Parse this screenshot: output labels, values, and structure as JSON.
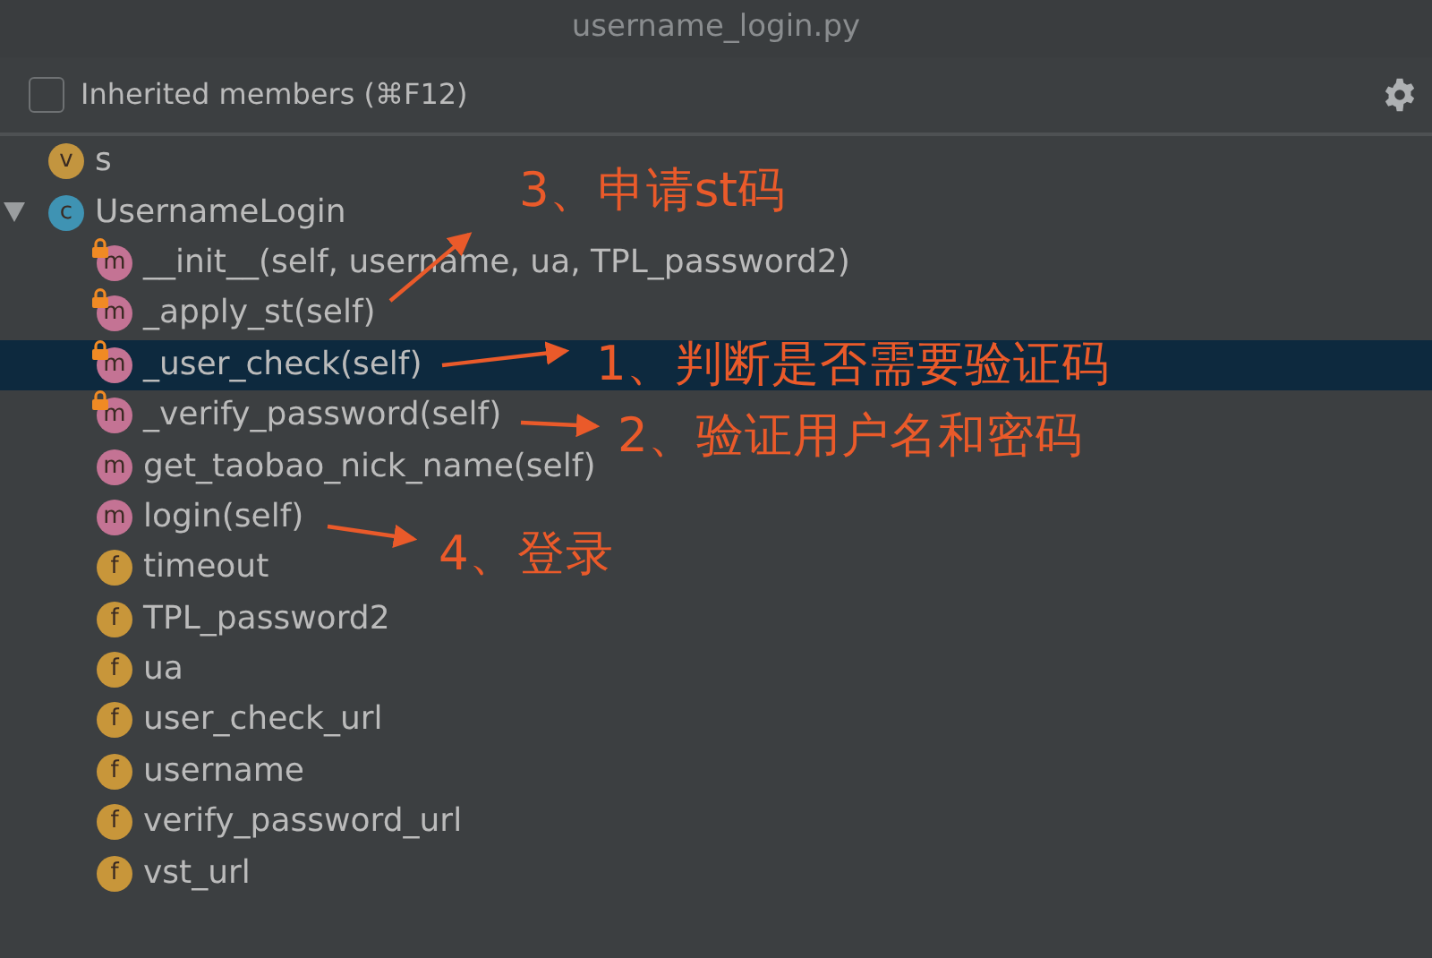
{
  "window": {
    "title": "username_login.py"
  },
  "inherited_members": {
    "label": "Inherited members (⌘F12)",
    "checked": false
  },
  "tree": [
    {
      "kind": "variable",
      "badge": "v",
      "label": "s",
      "locked": false,
      "selected": false
    },
    {
      "kind": "class",
      "badge": "c",
      "label": "UsernameLogin",
      "locked": false,
      "selected": false,
      "expanded": true,
      "children": [
        {
          "kind": "method",
          "badge": "m",
          "label": "__init__(self, username, ua, TPL_password2)",
          "locked": true,
          "selected": false
        },
        {
          "kind": "method",
          "badge": "m",
          "label": "_apply_st(self)",
          "locked": true,
          "selected": false
        },
        {
          "kind": "method",
          "badge": "m",
          "label": "_user_check(self)",
          "locked": true,
          "selected": true
        },
        {
          "kind": "method",
          "badge": "m",
          "label": "_verify_password(self)",
          "locked": true,
          "selected": false
        },
        {
          "kind": "method",
          "badge": "m",
          "label": "get_taobao_nick_name(self)",
          "locked": false,
          "selected": false
        },
        {
          "kind": "method",
          "badge": "m",
          "label": "login(self)",
          "locked": false,
          "selected": false
        },
        {
          "kind": "field",
          "badge": "f",
          "label": "timeout",
          "locked": false,
          "selected": false
        },
        {
          "kind": "field",
          "badge": "f",
          "label": "TPL_password2",
          "locked": false,
          "selected": false
        },
        {
          "kind": "field",
          "badge": "f",
          "label": "ua",
          "locked": false,
          "selected": false
        },
        {
          "kind": "field",
          "badge": "f",
          "label": "user_check_url",
          "locked": false,
          "selected": false
        },
        {
          "kind": "field",
          "badge": "f",
          "label": "username",
          "locked": false,
          "selected": false
        },
        {
          "kind": "field",
          "badge": "f",
          "label": "verify_password_url",
          "locked": false,
          "selected": false
        },
        {
          "kind": "field",
          "badge": "f",
          "label": "vst_url",
          "locked": false,
          "selected": false
        }
      ]
    }
  ],
  "annotations": [
    {
      "text": "3、申请st码"
    },
    {
      "text": "1、判断是否需要验证码"
    },
    {
      "text": "2、验证用户名和密码"
    },
    {
      "text": "4、登录"
    }
  ]
}
